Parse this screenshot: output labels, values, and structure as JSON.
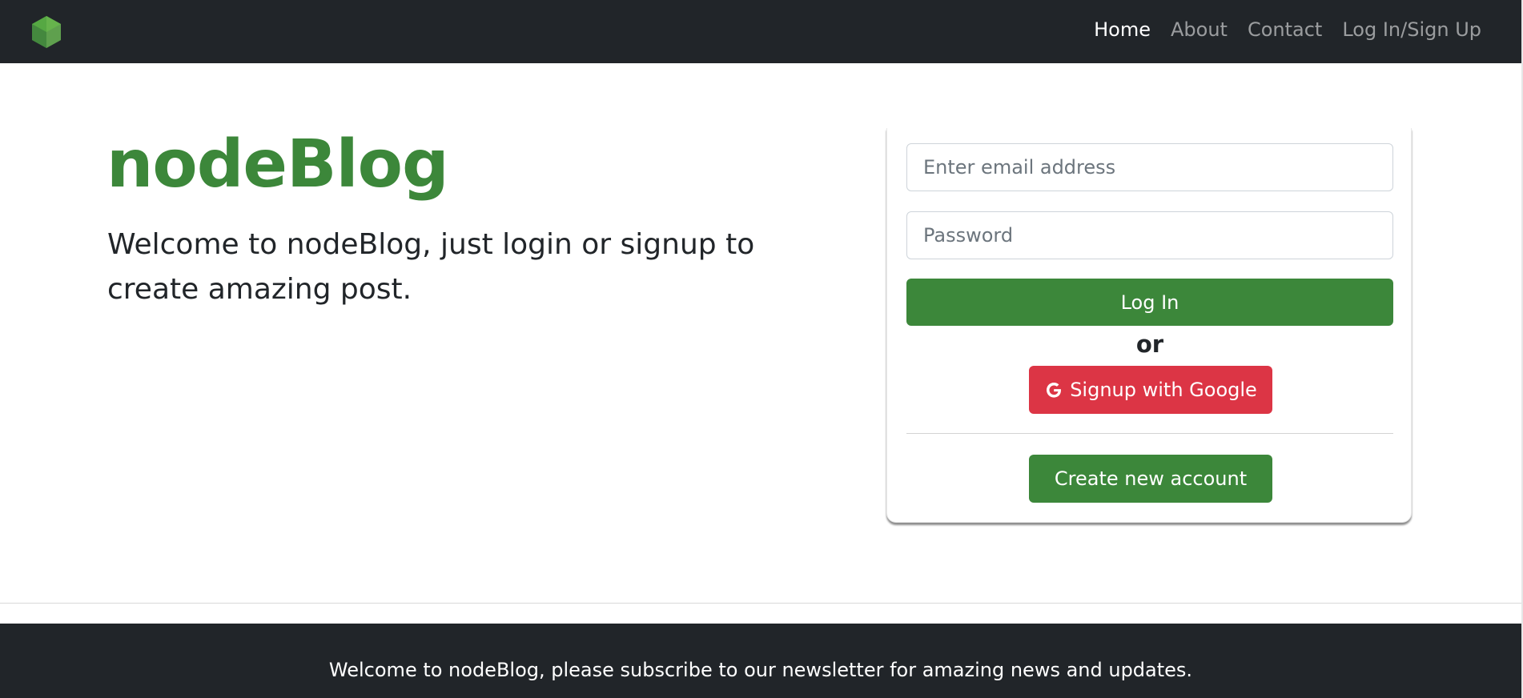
{
  "nav": {
    "logo_icon": "node-hexagon-icon",
    "links": [
      {
        "label": "Home",
        "active": true
      },
      {
        "label": "About",
        "active": false
      },
      {
        "label": "Contact",
        "active": false
      },
      {
        "label": "Log In/Sign Up",
        "active": false
      }
    ]
  },
  "hero": {
    "title": "nodeBlog",
    "text": "Welcome to nodeBlog, just login or signup to create amazing post."
  },
  "login": {
    "email_placeholder": "Enter email address",
    "email_value": "",
    "password_placeholder": "Password",
    "password_value": "",
    "login_label": "Log In",
    "or_label": "or",
    "google_icon": "google-g-icon",
    "google_label": "Signup with Google",
    "create_label": "Create new account"
  },
  "footer": {
    "text": "Welcome to nodeBlog, please subscribe to our newsletter for amazing news and updates."
  },
  "colors": {
    "navbar_bg": "#212529",
    "brand_green": "#3c873a",
    "google_red": "#dc3545",
    "text_dark": "#212529"
  }
}
